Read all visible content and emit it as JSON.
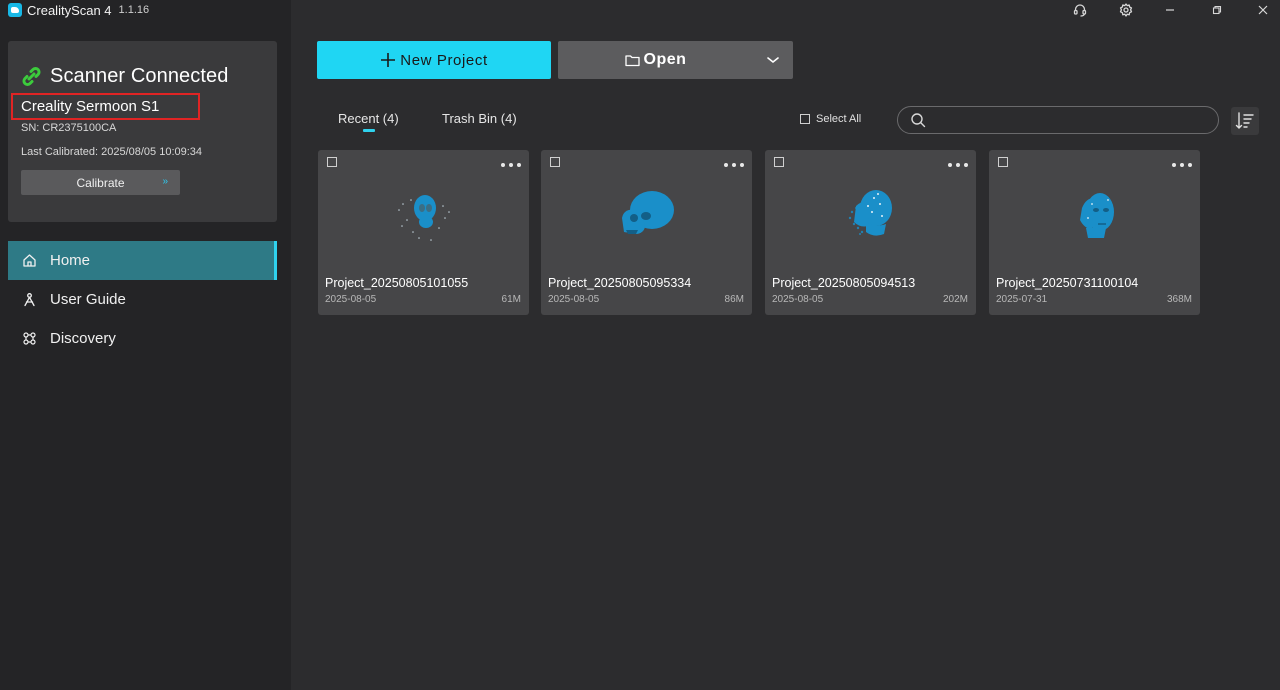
{
  "app": {
    "name": "CrealityScan 4",
    "version": "1.1.16"
  },
  "scanner": {
    "status": "Scanner Connected",
    "model": "Creality Sermoon S1",
    "sn": "SN: CR2375100CA",
    "last_calibrated": "Last Calibrated: 2025/08/05 10:09:34",
    "calibrate_label": "Calibrate",
    "calibrate_chevron": "»"
  },
  "nav": [
    {
      "label": "Home",
      "icon": "home-icon",
      "active": true
    },
    {
      "label": "User Guide",
      "icon": "user-guide-icon",
      "active": false
    },
    {
      "label": "Discovery",
      "icon": "discovery-icon",
      "active": false
    }
  ],
  "toolbar": {
    "new_project_label": "New Project",
    "open_label": "Open"
  },
  "tabs": [
    {
      "label": "Recent (4)",
      "active": true
    },
    {
      "label": "Trash Bin (4)",
      "active": false
    }
  ],
  "select_all_label": "Select All",
  "search": {
    "placeholder": ""
  },
  "projects": [
    {
      "name": "Project_20250805101055",
      "date": "2025-08-05",
      "size": "61M"
    },
    {
      "name": "Project_20250805095334",
      "date": "2025-08-05",
      "size": "86M"
    },
    {
      "name": "Project_20250805094513",
      "date": "2025-08-05",
      "size": "202M"
    },
    {
      "name": "Project_20250731100104",
      "date": "2025-07-31",
      "size": "368M"
    }
  ],
  "colors": {
    "accent": "#1fd6f3",
    "active_nav": "#2e7a86",
    "highlight_box": "#e02424",
    "status_green": "#3ccc3c",
    "scan_blue": "#1a8fc9"
  }
}
